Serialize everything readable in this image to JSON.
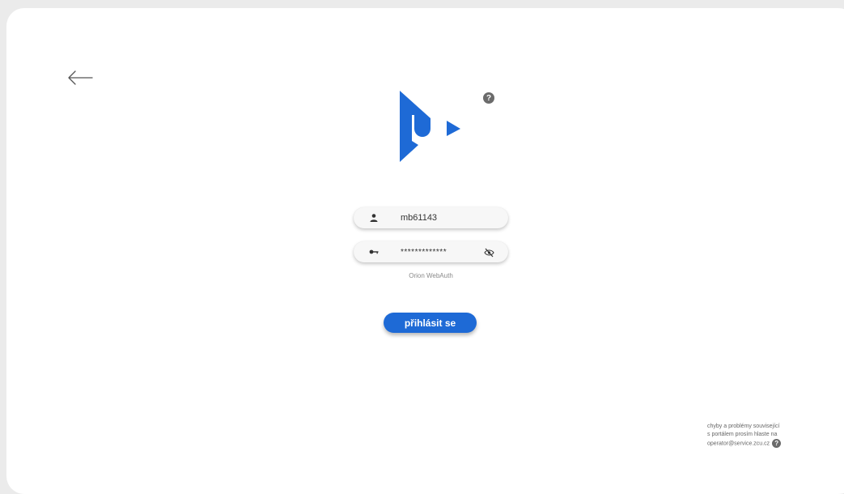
{
  "login": {
    "username_value": "mb61143",
    "password_value": "*************",
    "auth_method": "Orion WebAuth",
    "submit_label": "přihlásit se"
  },
  "help": {
    "glyph": "?"
  },
  "footer": {
    "line1": "chyby a problémy související",
    "line2": "s portálem prosím hlaste na",
    "email": "operator@service.zcu.cz"
  },
  "icons": {
    "back": "arrow-left-icon",
    "logo": "zcu-logo",
    "user": "user-icon",
    "key": "key-icon",
    "eye": "eye-slash-icon",
    "help": "help-icon"
  },
  "colors": {
    "brand_blue": "#1e6ad6",
    "background": "#ebebeb",
    "card": "#ffffff",
    "help_grey": "#6b6b6b"
  }
}
